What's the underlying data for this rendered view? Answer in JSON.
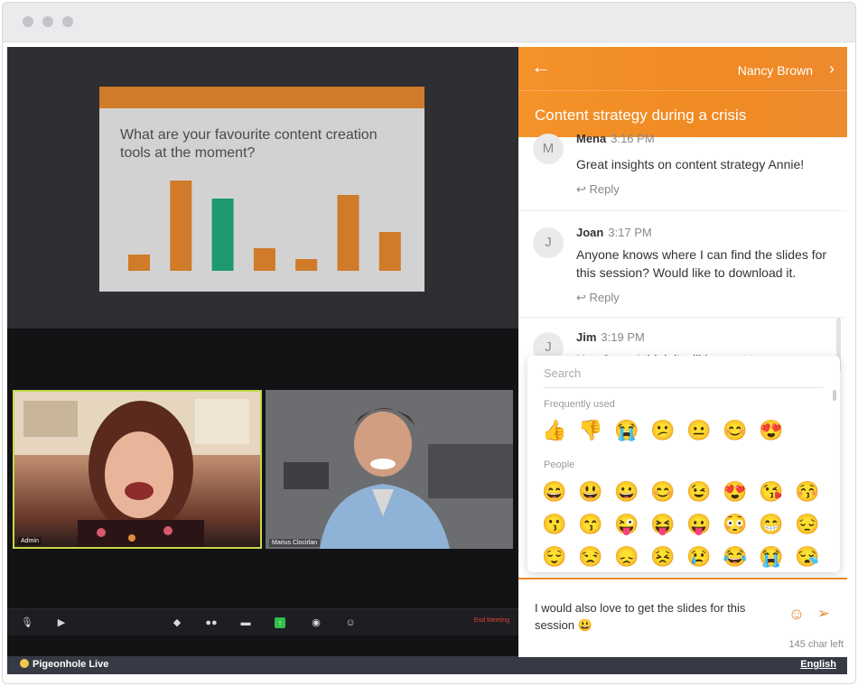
{
  "slide": {
    "question": "What are your favourite content creation tools at the moment?"
  },
  "chart_data": {
    "type": "bar",
    "categories": [
      "",
      "",
      "",
      "",
      "",
      "",
      ""
    ],
    "values": [
      18,
      100,
      80,
      25,
      13,
      84,
      43
    ],
    "colors": [
      "#cf7b29",
      "#cf7b29",
      "#1f9a6e",
      "#cf7b29",
      "#cf7b29",
      "#cf7b29",
      "#cf7b29"
    ],
    "ylim": [
      0,
      100
    ]
  },
  "video": {
    "tiles": [
      {
        "name": "Admin"
      },
      {
        "name": "Marius Clocirlan"
      }
    ],
    "end_meeting": "End Meeting"
  },
  "footer": {
    "brand": "Pigeonhole Live",
    "language": "English"
  },
  "panel": {
    "host": "Nancy Brown",
    "session_title": "Content strategy during a crisis",
    "messages": [
      {
        "initial": "M",
        "name": "Mena",
        "time": "3:16 PM",
        "text": "Great insights on content strategy Annie!",
        "reply": "Reply"
      },
      {
        "initial": "J",
        "name": "Joan",
        "time": "3:17 PM",
        "text": "Anyone knows where I can find the slides for this session? Would like to download it.",
        "reply": "Reply"
      },
      {
        "initial": "J",
        "name": "Jim",
        "time": "3:19 PM",
        "text": "Hey Joan, I think it will be sent to"
      }
    ]
  },
  "emoji_picker": {
    "search_placeholder": "Search",
    "frequently_used_label": "Frequently used",
    "people_label": "People",
    "frequently_used": [
      "👍",
      "👎",
      "😭",
      "😕",
      "😐",
      "😊",
      "😍"
    ],
    "people_rows": [
      [
        "😄",
        "😃",
        "😀",
        "😊",
        "😉",
        "😍",
        "😘",
        "😚"
      ],
      [
        "😗",
        "😙",
        "😜",
        "😝",
        "😛",
        "😳",
        "😁",
        "😔"
      ],
      [
        "😌",
        "😒",
        "😞",
        "😣",
        "😢",
        "😂",
        "😭",
        "😪"
      ]
    ]
  },
  "compose": {
    "text": "I would also love to get the slides for this session 😃",
    "char_left": "145 char left"
  },
  "accent_color": "#f08a22"
}
